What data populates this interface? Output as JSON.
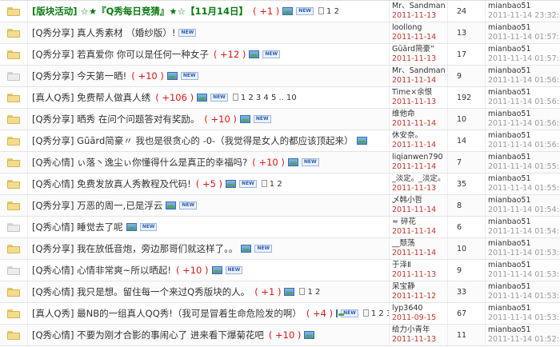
{
  "threads": [
    {
      "title": "[版块活动] ☆★『Q秀每日竞猜』★☆【11月14日】",
      "bold": true,
      "score": "( +1 )",
      "pic": true,
      "new": true,
      "new_text": "NEW",
      "pages": "1 2",
      "author": "Mr、Sandman",
      "date": "2011-11-13",
      "replies": "24",
      "last_user": "mianbao51",
      "last_time": "2011-11-14 23:32:..",
      "grey": false
    },
    {
      "title": "[Q秀分享] 真人秀素材 （婚纱版）!",
      "bold": false,
      "score": "",
      "pic": false,
      "new": true,
      "new_text": "NEW",
      "pages": "",
      "author": "loollong",
      "date": "2011-11-14",
      "replies": "13",
      "last_user": "mianbao51",
      "last_time": "2011-11-14 01:57:..",
      "grey": false
    },
    {
      "title": "[Q秀分享] 若真爱你 你可以是任何一种女子",
      "bold": false,
      "score": "( +12 )",
      "pic": true,
      "new": true,
      "new_text": "NEW",
      "pages": "",
      "author": "Gūārd简豪”",
      "date": "2011-11-13",
      "replies": "17",
      "last_user": "mianbao51",
      "last_time": "2011-11-14 01:57:..",
      "grey": false
    },
    {
      "title": "[Q秀分享] 今天第一晒!",
      "bold": false,
      "score": "( +10 )",
      "pic": true,
      "new": true,
      "new_text": "NEW",
      "pages": "",
      "author": "Mr、Sandman",
      "date": "2011-11-14",
      "replies": "9",
      "last_user": "mianbao51",
      "last_time": "2011-11-14 01:56:..",
      "grey": true
    },
    {
      "title": "[真人Q秀] 免费帮人做真人绣",
      "bold": false,
      "score": "( +106 )",
      "pic": true,
      "new": true,
      "new_text": "NEW",
      "pages": "1 2 3 4 5 .. 10",
      "author": "Time×余恨",
      "date": "2011-11-13",
      "replies": "192",
      "last_user": "mianbao51",
      "last_time": "2011-11-14 01:56:..",
      "grey": false
    },
    {
      "title": "[Q秀分享] 晒秀 在问个问题答对有奖励。",
      "bold": false,
      "score": "( +10 )",
      "pic": true,
      "new": true,
      "new_text": "NEW",
      "pages": "",
      "author": "维他命",
      "date": "2011-11-14",
      "replies": "10",
      "last_user": "mianbao51",
      "last_time": "2011-11-14 01:56:..",
      "grey": false
    },
    {
      "title": "[Q秀分享] Gūārd简豪〃 我也是很贪心的 -0-（我觉得是女人的都应该顶起来）",
      "bold": false,
      "score": "",
      "pic": true,
      "new": false,
      "new_text": "",
      "pages": "",
      "author": "休安奈。",
      "date": "2011-11-14",
      "replies": "14",
      "last_user": "mianbao51",
      "last_time": "2011-11-14 01:56:..",
      "grey": false
    },
    {
      "title": "[Q秀心情] ぃ落丶逸尘ぃ你懂得什么是真正的幸福吗?",
      "bold": false,
      "score": "( +10 )",
      "pic": true,
      "new": true,
      "new_text": "NEW",
      "pages": "",
      "author": "liqianwen790",
      "date": "2011-11-14",
      "replies": "7",
      "last_user": "mianbao51",
      "last_time": "2011-11-14 01:55:..",
      "grey": false
    },
    {
      "title": "[Q秀心情] 免费发放真人秀教程及代码!",
      "bold": false,
      "score": "( +5 )",
      "pic": true,
      "new": true,
      "new_text": "NEW",
      "pages": "1 2",
      "author": "_淡定。_淡定。",
      "date": "2011-11-13",
      "replies": "35",
      "last_user": "mianbao51",
      "last_time": "2011-11-14 01:55:..",
      "grey": false
    },
    {
      "title": "[Q秀分享] 万恶的周一,已是浮云",
      "bold": false,
      "score": "",
      "pic": true,
      "new": true,
      "new_text": "NEW",
      "pages": "",
      "author": "乄韩小哲",
      "date": "2011-11-14",
      "replies": "8",
      "last_user": "mianbao51",
      "last_time": "2011-11-14 01:54:..",
      "grey": false
    },
    {
      "title": "[Q秀心情] 睡觉去了呢",
      "bold": false,
      "score": "",
      "pic": true,
      "new": true,
      "new_text": "NEW",
      "pages": "",
      "author": "≈     碎花",
      "date": "2011-11-14",
      "replies": "6",
      "last_user": "mianbao51",
      "last_time": "2011-11-14 01:54:..",
      "grey": true
    },
    {
      "title": "[Q秀分享] 我在放低音炮，旁边那哥们就这样了。。",
      "bold": false,
      "score": "",
      "pic": true,
      "new": true,
      "new_text": "NEW",
      "pages": "",
      "author": "__颓荡",
      "date": "2011-11-14",
      "replies": "10",
      "last_user": "mianbao51",
      "last_time": "2011-11-14 01:53:..",
      "grey": false
    },
    {
      "title": "[Q秀心情] 心情非常爽~所以晒起!",
      "bold": false,
      "score": "( +10 )",
      "pic": true,
      "new": true,
      "new_text": "NEW",
      "pages": "",
      "author": "于泽Ⅱ",
      "date": "2011-11-13",
      "replies": "9",
      "last_user": "mianbao51",
      "last_time": "2011-11-14 01:53:..",
      "grey": true
    },
    {
      "title": "[Q秀心情] 我只是想。留住每一个来过Q秀版块的人。",
      "bold": false,
      "score": "( +1 )",
      "pic": true,
      "new": false,
      "new_text": "",
      "pages": "1 2",
      "author": "呆宝静",
      "date": "2011-11-12",
      "replies": "33",
      "last_user": "mianbao51",
      "last_time": "2011-11-14 01:53:..",
      "grey": false
    },
    {
      "title": "[真人Q秀] 最NB的一组真人QQ秀!（我可是冒着生命危险发的啊）",
      "bold": false,
      "score": "( +4 )",
      "pic": true,
      "new": true,
      "new_text": "NEW",
      "pages": "1 2 3 4",
      "author": "lyp3640",
      "date": "2011-09-15",
      "replies": "67",
      "last_user": "mianbao51",
      "last_time": "2011-11-14 01:53:..",
      "grey": false
    },
    {
      "title": "[Q秀心情] 不要为刚才合影的事闹心了 进来看下爆菊花吧",
      "bold": false,
      "score": "( +10 )",
      "pic": true,
      "new": false,
      "new_text": "",
      "pages": "",
      "author": "给力小青年",
      "date": "2011-11-13",
      "replies": "11",
      "last_user": "mianbao51",
      "last_time": "2011-11-14 01:52:..",
      "grey": false
    }
  ]
}
